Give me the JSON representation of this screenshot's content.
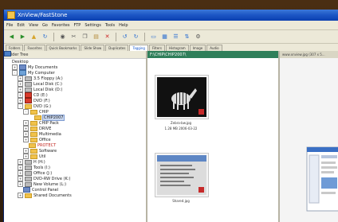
{
  "window": {
    "title": "XnView/FastStone",
    "menus": [
      "File",
      "Edit",
      "View",
      "Go",
      "Favorites",
      "FTP",
      "Settings",
      "Tools",
      "Help"
    ]
  },
  "toolbar": {
    "buttons": [
      {
        "icon": "back-arrow-icon",
        "glyph": "◀",
        "color": "#2c8f2c"
      },
      {
        "icon": "forward-arrow-icon",
        "glyph": "▶",
        "color": "#2c8f2c"
      },
      {
        "icon": "up-folder-icon",
        "glyph": "▲",
        "color": "#d6a42a"
      },
      {
        "icon": "refresh-icon",
        "glyph": "↻",
        "color": "#2c6fd1"
      },
      {
        "icon": "binoculars-icon",
        "glyph": "◉",
        "color": "#555"
      },
      {
        "icon": "cut-icon",
        "glyph": "✂",
        "color": "#555"
      },
      {
        "icon": "copy-icon",
        "glyph": "❐",
        "color": "#555"
      },
      {
        "icon": "paste-icon",
        "glyph": "▤",
        "color": "#b38b3a"
      },
      {
        "icon": "delete-icon",
        "glyph": "✕",
        "color": "#c22"
      },
      {
        "icon": "rotate-left-icon",
        "glyph": "↺",
        "color": "#2c6fd1"
      },
      {
        "icon": "rotate-right-icon",
        "glyph": "↻",
        "color": "#2c6fd1"
      },
      {
        "icon": "monitor-icon",
        "glyph": "▭",
        "color": "#2c6fd1"
      },
      {
        "icon": "thumbnail-view-icon",
        "glyph": "▦",
        "color": "#2c6fd1"
      },
      {
        "icon": "details-view-icon",
        "glyph": "☰",
        "color": "#2c6fd1"
      },
      {
        "icon": "sort-icon",
        "glyph": "⇅",
        "color": "#2c6fd1"
      },
      {
        "icon": "settings-icon",
        "glyph": "⚙",
        "color": "#555"
      }
    ]
  },
  "tabs": [
    "Folders",
    "Favorites",
    "Quick Bookmarks",
    "Slide Show",
    "Duplicates",
    "Tagging",
    "Filters",
    "Histogram",
    "Image",
    "Audio"
  ],
  "tabs_active_index": 5,
  "folder_pane": {
    "header": "Folder Tree",
    "items": [
      {
        "label": "Desktop",
        "icon": "desktop",
        "depth": 0,
        "exp": ""
      },
      {
        "label": "My Documents",
        "icon": "doc",
        "depth": 1,
        "exp": "+"
      },
      {
        "label": "My Computer",
        "icon": "computer",
        "depth": 1,
        "exp": "-"
      },
      {
        "label": "3.5 Floppy (A:)",
        "icon": "drive",
        "depth": 2,
        "exp": "+"
      },
      {
        "label": "Local Disk (C:)",
        "icon": "drive",
        "depth": 2,
        "exp": "+"
      },
      {
        "label": "Local Disk (D:)",
        "icon": "drive",
        "depth": 2,
        "exp": "+"
      },
      {
        "label": "CD (E:)",
        "icon": "red",
        "depth": 2,
        "exp": "+"
      },
      {
        "label": "DVD (F:)",
        "icon": "red",
        "depth": 2,
        "exp": "+"
      },
      {
        "label": "DVD (G:)",
        "icon": "folder",
        "depth": 2,
        "exp": "-"
      },
      {
        "label": "CHIP",
        "icon": "folder",
        "depth": 3,
        "exp": "-"
      },
      {
        "label": "CHIP2007",
        "icon": "folder",
        "depth": 4,
        "exp": "",
        "selected": true
      },
      {
        "label": "CHIP Pack",
        "icon": "folder",
        "depth": 3,
        "exp": "+"
      },
      {
        "label": "DRIVE",
        "icon": "folder",
        "depth": 3,
        "exp": "+"
      },
      {
        "label": "Multimedia",
        "icon": "folder",
        "depth": 3,
        "exp": "+"
      },
      {
        "label": "Office",
        "icon": "folder",
        "depth": 3,
        "exp": "+"
      },
      {
        "label": "PROTECT",
        "icon": "folder",
        "depth": 3,
        "exp": "",
        "red": true
      },
      {
        "label": "Software",
        "icon": "folder",
        "depth": 3,
        "exp": "+"
      },
      {
        "label": "Util",
        "icon": "folder",
        "depth": 3,
        "exp": "+"
      },
      {
        "label": "H (H:)",
        "icon": "drive",
        "depth": 2,
        "exp": "+"
      },
      {
        "label": "Tools (I:)",
        "icon": "drive",
        "depth": 2,
        "exp": "+"
      },
      {
        "label": "Office (J:)",
        "icon": "drive",
        "depth": 2,
        "exp": "+"
      },
      {
        "label": "DVD-RW Drive (K:)",
        "icon": "drive",
        "depth": 2,
        "exp": "+"
      },
      {
        "label": "New Volume (L:)",
        "icon": "drive",
        "depth": 2,
        "exp": "+"
      },
      {
        "label": "Control Panel",
        "icon": "doc",
        "depth": 2,
        "exp": ""
      },
      {
        "label": "Shared Documents",
        "icon": "folder",
        "depth": 2,
        "exp": "+"
      }
    ]
  },
  "thumbs_pane": {
    "header": "F:\\CHIP\\CHIP2007\\",
    "items": [
      {
        "caption": "Zebra-bw.jpg",
        "detail": "1.28 MB 2006-03-22"
      },
      {
        "caption": "Shared.jpg",
        "detail": ""
      }
    ]
  },
  "preview_pane": {
    "header": "www.xnview.jpg  (307 x 5..."
  }
}
